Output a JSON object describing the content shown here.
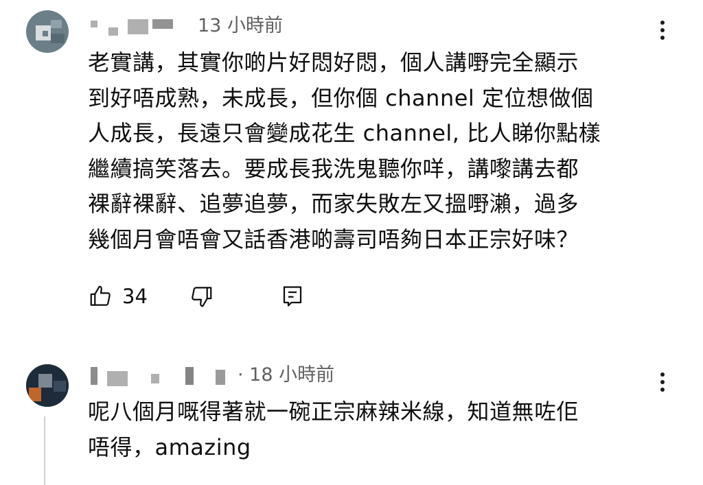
{
  "comments": [
    {
      "time": "13 小時前",
      "lines": [
        "老實講，其實你啲片好悶好悶，個人講嘢完全顯示",
        "到好唔成熟，未成長，但你個 channel 定位想做個",
        "人成長，長遠只會變成花生 channel, 比人睇你點樣",
        "繼續搞笑落去。要成長我洗鬼聽你咩，講嚟講去都",
        "裸辭裸辭、追夢追夢，而家失敗左又搵嘢瀨，過多",
        "幾個月會唔會又話香港啲壽司唔夠日本正宗好味？"
      ],
      "like_count": "34",
      "icons": {
        "like": "thumbs-up-icon",
        "dislike": "thumbs-down-icon",
        "reply": "comment-icon",
        "menu": "more-vert-icon"
      }
    },
    {
      "time": "· 18 小時前",
      "lines": [
        "呢八個月嘅得著就一碗正宗麻辣米線，知道無咗佢",
        "唔得，amazing"
      ],
      "icons": {
        "menu": "more-vert-icon"
      }
    }
  ],
  "colors": {
    "text": "#0f0f0f",
    "meta": "#606060",
    "background": "#ffffff"
  }
}
